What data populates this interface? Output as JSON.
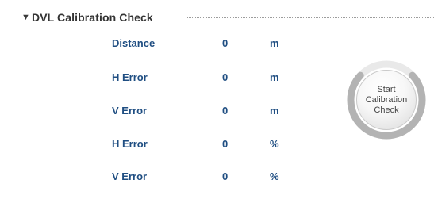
{
  "section": {
    "title": "DVL Calibration Check",
    "expander_glyph": "▼"
  },
  "metrics": [
    {
      "label": "Distance",
      "value": "0",
      "unit": "m"
    },
    {
      "label": "H Error",
      "value": "0",
      "unit": "m"
    },
    {
      "label": "V Error",
      "value": "0",
      "unit": "m"
    },
    {
      "label": "H Error",
      "value": "0",
      "unit": "%"
    },
    {
      "label": "V Error",
      "value": "0",
      "unit": "%"
    }
  ],
  "calibration_button": {
    "label": "Start\nCalibration\nCheck"
  },
  "colors": {
    "label_text": "#1f4e82",
    "title_text": "#333333",
    "ring": "#b3b3b3"
  }
}
